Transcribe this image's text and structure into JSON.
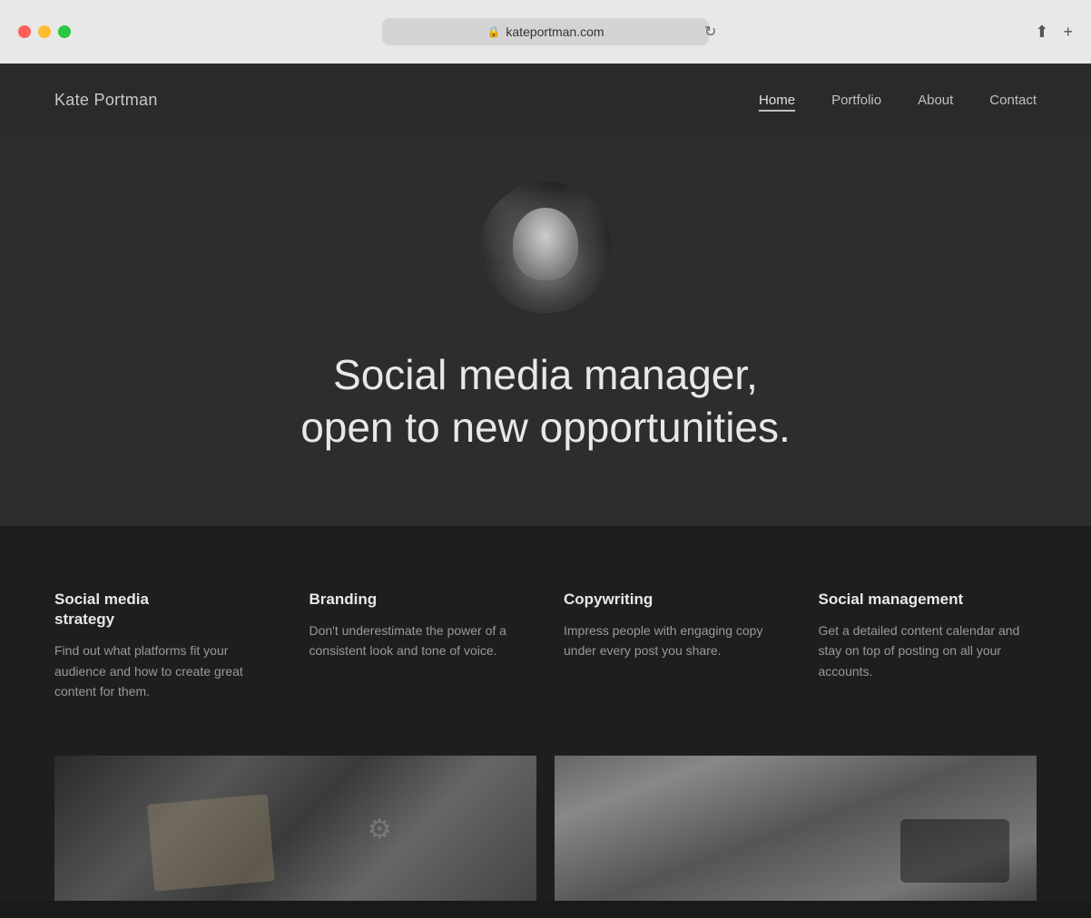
{
  "browser": {
    "url": "kateportman.com",
    "reload_label": "↻",
    "share_label": "⬆",
    "new_tab_label": "+"
  },
  "nav": {
    "logo": "Kate Portman",
    "links": [
      {
        "label": "Home",
        "active": true
      },
      {
        "label": "Portfolio",
        "active": false
      },
      {
        "label": "About",
        "active": false
      },
      {
        "label": "Contact",
        "active": false
      }
    ]
  },
  "hero": {
    "title_line1": "Social media manager,",
    "title_line2": "open to new opportunities."
  },
  "services": [
    {
      "title": "Social media strategy",
      "description": "Find out what platforms fit your audience and how to create great content for them."
    },
    {
      "title": "Branding",
      "description": "Don't underestimate the power of a consistent look and tone of voice."
    },
    {
      "title": "Copywriting",
      "description": "Impress people with engaging copy under every post you share."
    },
    {
      "title": "Social management",
      "description": "Get a detailed content calendar and stay on top of posting on all your accounts."
    }
  ],
  "colors": {
    "hero_bg": "#2d2d2d",
    "services_bg": "#1e1e1e",
    "nav_bg": "#2a2a2a",
    "accent_text": "#e8e8e8",
    "muted_text": "#999999"
  }
}
